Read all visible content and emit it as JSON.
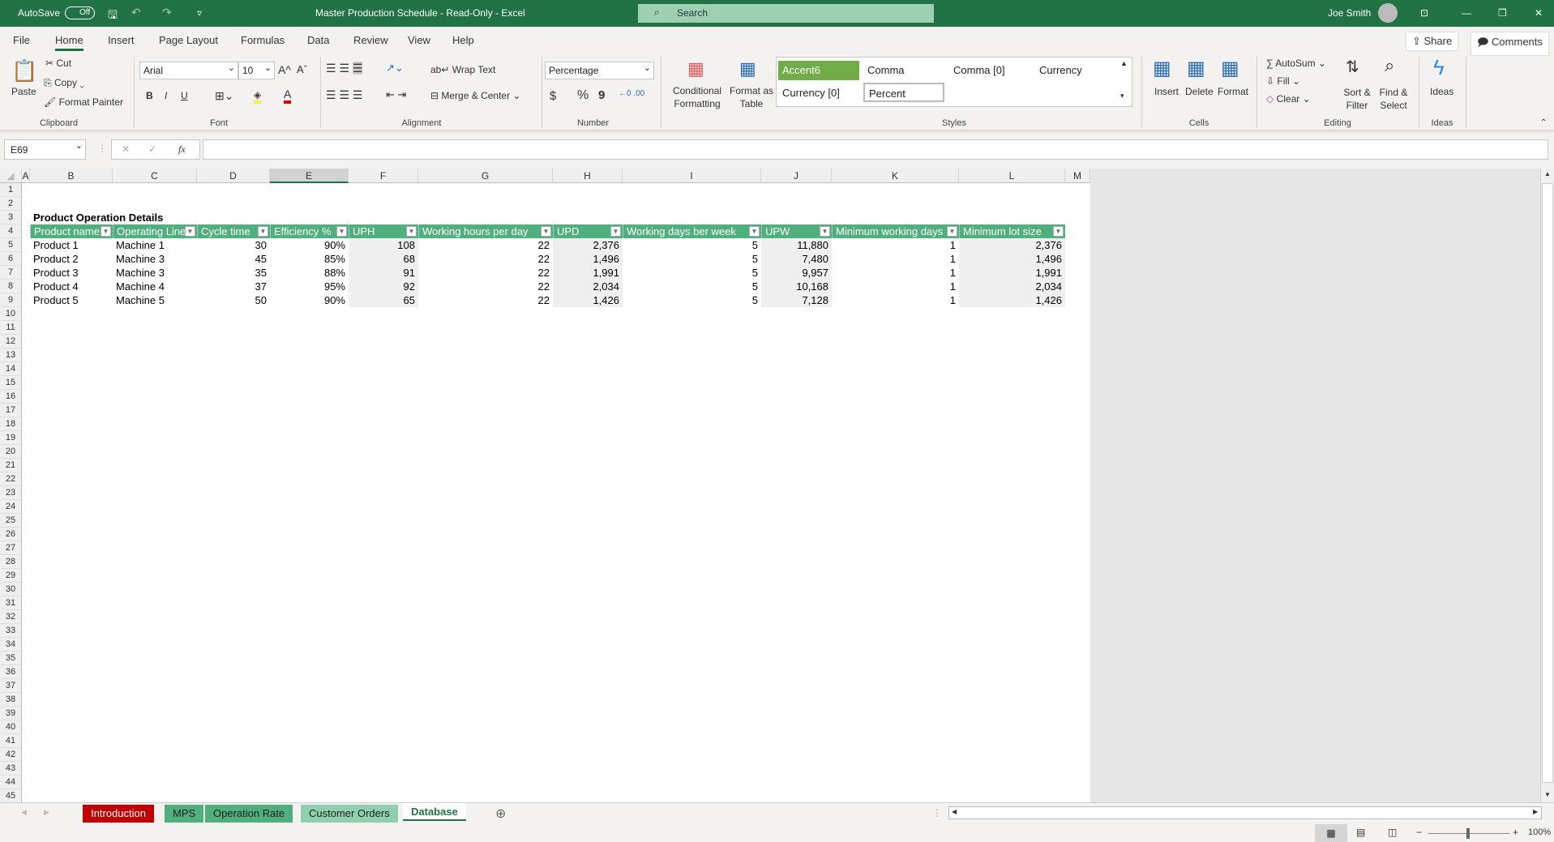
{
  "titlebar": {
    "autosave": "AutoSave",
    "autosave_state": "Off",
    "title": "Master Production Schedule  -  Read-Only  -  Excel",
    "search_placeholder": "Search",
    "user": "Joe Smith"
  },
  "tabs": [
    "File",
    "Home",
    "Insert",
    "Page Layout",
    "Formulas",
    "Data",
    "Review",
    "View",
    "Help"
  ],
  "active_tab": "Home",
  "share": "Share",
  "comments": "Comments",
  "ribbon": {
    "clipboard": {
      "label": "Clipboard",
      "paste": "Paste",
      "cut": "Cut",
      "copy": "Copy",
      "format_painter": "Format Painter"
    },
    "font": {
      "label": "Font",
      "name": "Arial",
      "size": "10",
      "bold": "B",
      "italic": "I",
      "underline": "U",
      "grow": "A^",
      "shrink": "Aˇ"
    },
    "alignment": {
      "label": "Alignment",
      "wrap": "Wrap Text",
      "merge": "Merge & Center"
    },
    "number": {
      "label": "Number",
      "format": "Percentage",
      "currency": "$",
      "percent": "%",
      "comma": "9"
    },
    "styles": {
      "label": "Styles",
      "conditional": "Conditional Formatting",
      "format_table": "Format as Table",
      "gallery": [
        "Accent6",
        "Comma",
        "Comma [0]",
        "Currency",
        "Currency [0]",
        "Percent"
      ]
    },
    "cells": {
      "label": "Cells",
      "insert": "Insert",
      "delete": "Delete",
      "format": "Format"
    },
    "editing": {
      "label": "Editing",
      "autosum": "AutoSum",
      "fill": "Fill",
      "clear": "Clear",
      "sort": "Sort & Filter",
      "find": "Find & Select"
    },
    "ideas": {
      "label": "Ideas",
      "ideas": "Ideas"
    }
  },
  "formula_bar": {
    "name_box": "E69",
    "fx": "fx",
    "value": ""
  },
  "columns": [
    "A",
    "B",
    "C",
    "D",
    "E",
    "F",
    "G",
    "H",
    "I",
    "J",
    "K",
    "L",
    "M"
  ],
  "sheet": {
    "title": "Product Operation Details",
    "headers": [
      "Product name",
      "Operating Line",
      "Cycle time",
      "Efficiency %",
      "UPH",
      "Working hours per day",
      "UPD",
      "Working days ber week",
      "UPW",
      "Minimum working days",
      "Minimum lot size"
    ],
    "rows": [
      [
        "Product 1",
        "Machine 1",
        "30",
        "90%",
        "108",
        "22",
        "2,376",
        "5",
        "11,880",
        "1",
        "2,376"
      ],
      [
        "Product 2",
        "Machine 3",
        "45",
        "85%",
        "68",
        "22",
        "1,496",
        "5",
        "7,480",
        "1",
        "1,496"
      ],
      [
        "Product 3",
        "Machine 3",
        "35",
        "88%",
        "91",
        "22",
        "1,991",
        "5",
        "9,957",
        "1",
        "1,991"
      ],
      [
        "Product 4",
        "Machine 4",
        "37",
        "95%",
        "92",
        "22",
        "2,034",
        "5",
        "10,168",
        "1",
        "2,034"
      ],
      [
        "Product 5",
        "Machine 5",
        "50",
        "90%",
        "65",
        "22",
        "1,426",
        "5",
        "7,128",
        "1",
        "1,426"
      ]
    ]
  },
  "sheet_tabs": [
    {
      "label": "Introduction",
      "color": "#c00000"
    },
    {
      "label": "MPS",
      "color": "#4fb07d"
    },
    {
      "label": "Operation Rate",
      "color": "#4fb07d"
    },
    {
      "label": "Customer Orders",
      "color": "#8fd1ae"
    },
    {
      "label": "Database",
      "color": "#ffffff"
    }
  ],
  "active_sheet": "Database",
  "status": {
    "zoom": "100%"
  }
}
